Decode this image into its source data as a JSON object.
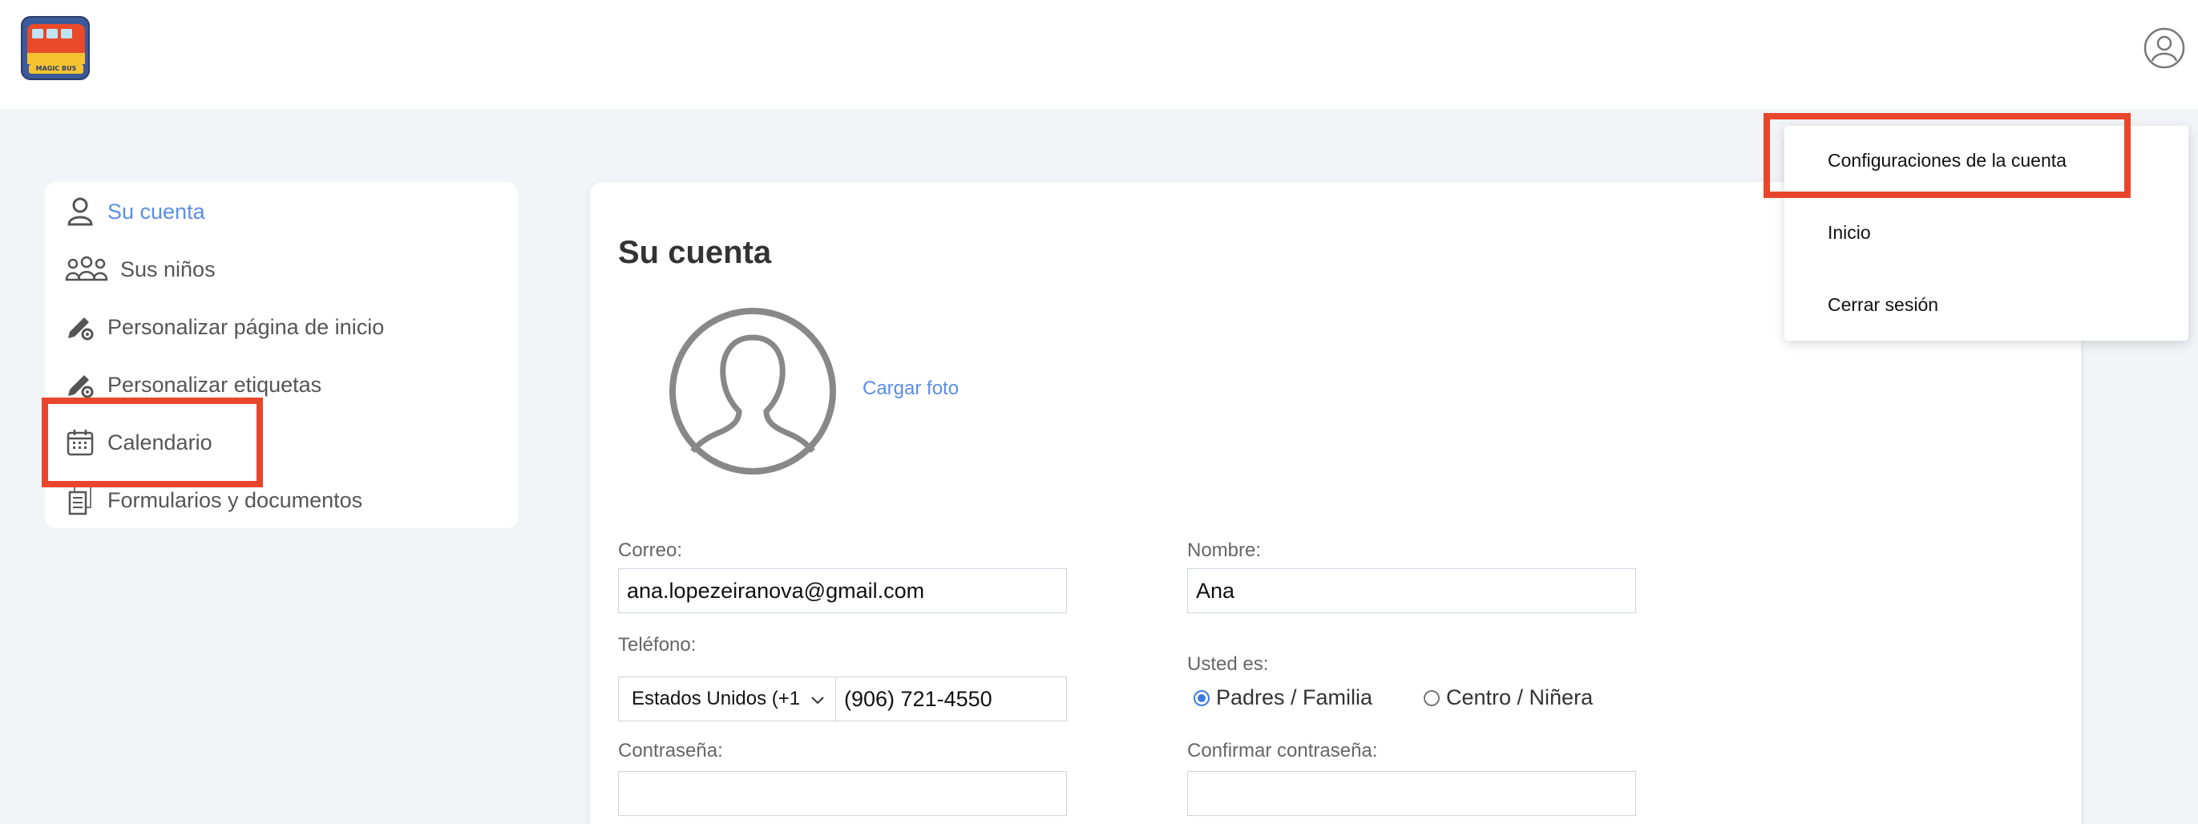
{
  "header": {
    "logo_text": "MAGIC BUS"
  },
  "sidebar": {
    "items": [
      {
        "label": "Su cuenta",
        "icon": "user-icon"
      },
      {
        "label": "Sus niños",
        "icon": "group-icon"
      },
      {
        "label": "Personalizar página de inicio",
        "icon": "edit-gear-icon"
      },
      {
        "label": "Personalizar etiquetas",
        "icon": "edit-gear-icon"
      },
      {
        "label": "Calendario",
        "icon": "calendar-icon"
      },
      {
        "label": "Formularios y documentos",
        "icon": "documents-icon"
      }
    ]
  },
  "account": {
    "title": "Su cuenta",
    "upload_photo": "Cargar foto",
    "email_label": "Correo:",
    "email_value": "ana.lopezeiranova@gmail.com",
    "name_label": "Nombre:",
    "name_value": "Ana",
    "phone_label": "Teléfono:",
    "phone_country": "Estados Unidos (+1",
    "phone_value": "(906) 721-4550",
    "role_label": "Usted es:",
    "role_options": [
      "Padres / Familia",
      "Centro / Niñera"
    ],
    "role_selected": "Padres / Familia",
    "password_label": "Contraseña:",
    "password_value": "",
    "confirm_password_label": "Confirmar contraseña:",
    "confirm_password_value": ""
  },
  "user_menu": {
    "items": [
      "Configuraciones de la cuenta",
      "Inicio",
      "Cerrar sesión"
    ]
  },
  "colors": {
    "accent": "#5b8ee8",
    "highlight": "#e8462c",
    "background": "#f3f4f8"
  }
}
